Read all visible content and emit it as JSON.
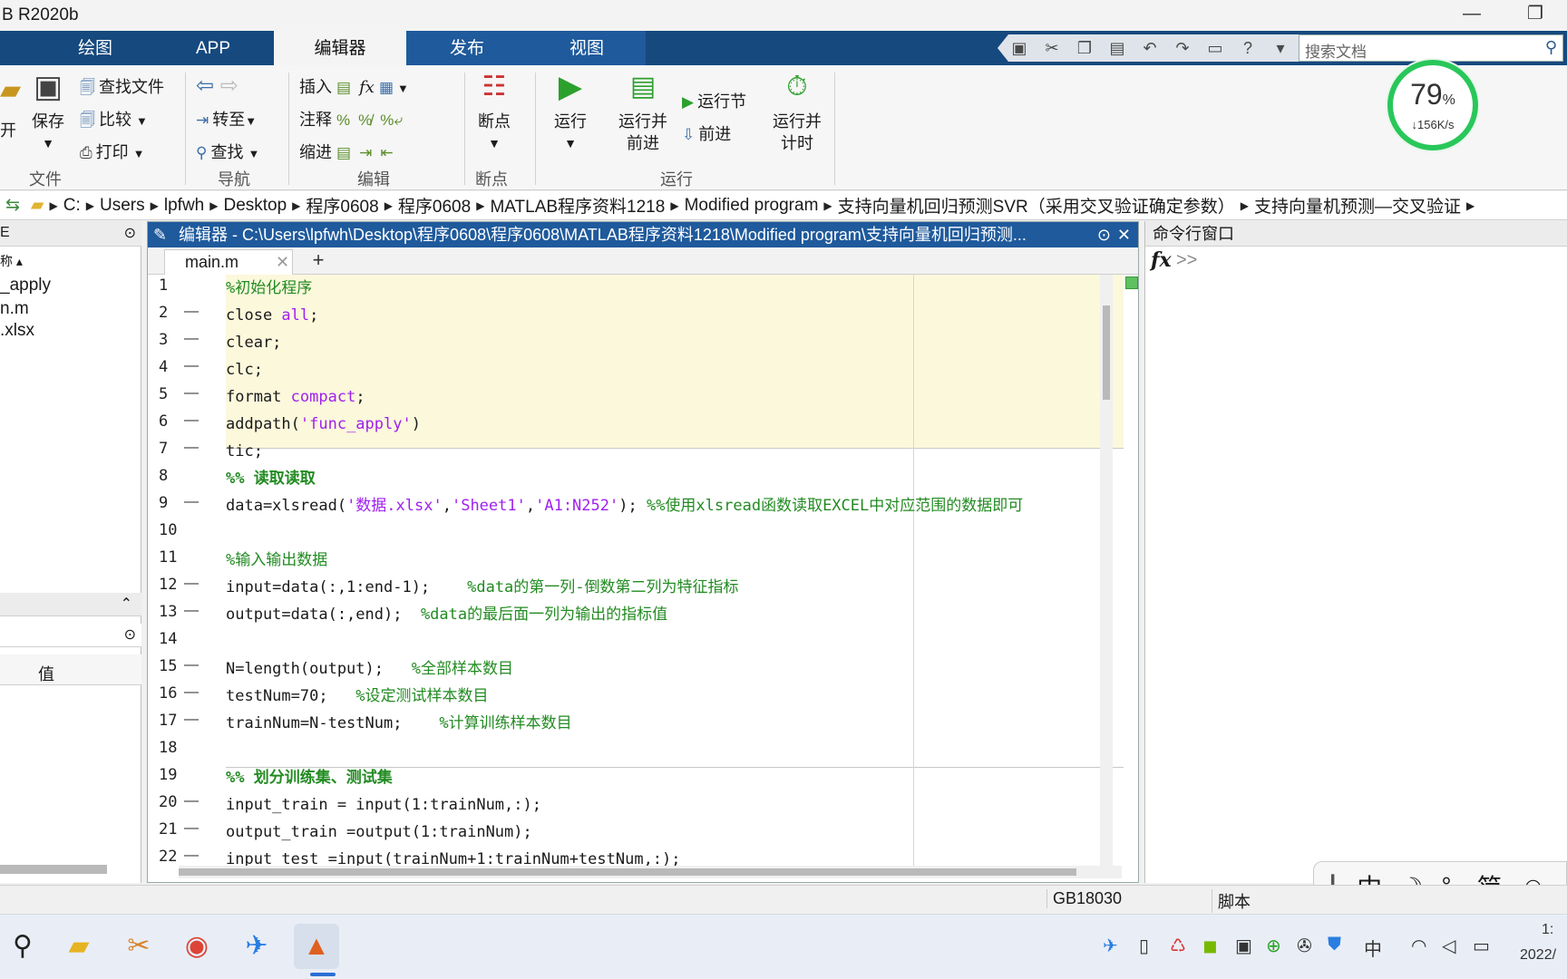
{
  "window": {
    "title": "B R2020b",
    "minimize": "—",
    "restore": "❐"
  },
  "tabs": [
    "绘图",
    "APP",
    "编辑器",
    "发布",
    "视图"
  ],
  "search": {
    "placeholder": "搜索文档"
  },
  "ribbon": {
    "file": {
      "open_partial": "开",
      "save": "保存",
      "find_files": "查找文件",
      "compare": "比较",
      "print": "打印",
      "group": "文件"
    },
    "nav": {
      "goto": "转至",
      "find": "查找",
      "group": "导航"
    },
    "edit": {
      "insert": "插入",
      "comment": "注释",
      "indent": "缩进",
      "group": "编辑"
    },
    "breakpoints": {
      "label": "断点",
      "group": "断点"
    },
    "run": {
      "run": "运行",
      "run_advance_1": "运行并",
      "run_advance_2": "前进",
      "run_section": "运行节",
      "advance": "前进",
      "run_time_1": "运行并",
      "run_time_2": "计时",
      "group": "运行"
    }
  },
  "meter": {
    "percent": "79",
    "percent_unit": "%",
    "speed": "↓156K/s"
  },
  "path": [
    "C:",
    "Users",
    "lpfwh",
    "Desktop",
    "程序0608",
    "程序0608",
    "MATLAB程序资料1218",
    "Modified program",
    "支持向量机回归预测SVR（采用交叉验证确定参数）",
    "支持向量机预测—交叉验证"
  ],
  "left_pane": {
    "header_partial": "E",
    "name_partial": "称",
    "files": [
      "_apply",
      "n.m",
      ".xlsx"
    ],
    "value_col": "值"
  },
  "editor": {
    "title": "编辑器 - C:\\Users\\lpfwh\\Desktop\\程序0608\\程序0608\\MATLAB程序资料1218\\Modified program\\支持向量机回归预测...",
    "tab": "main.m",
    "add_tab": "+",
    "lines": [
      {
        "n": "1",
        "dash": false,
        "parts": [
          {
            "t": "%初始化程序",
            "c": "cm"
          }
        ]
      },
      {
        "n": "2",
        "dash": true,
        "parts": [
          {
            "t": "close ",
            "c": ""
          },
          {
            "t": "all",
            "c": "kw"
          },
          {
            "t": ";",
            "c": ""
          }
        ]
      },
      {
        "n": "3",
        "dash": true,
        "parts": [
          {
            "t": "clear;",
            "c": ""
          }
        ]
      },
      {
        "n": "4",
        "dash": true,
        "parts": [
          {
            "t": "clc;",
            "c": ""
          }
        ]
      },
      {
        "n": "5",
        "dash": true,
        "parts": [
          {
            "t": "format ",
            "c": ""
          },
          {
            "t": "compact",
            "c": "kw"
          },
          {
            "t": ";",
            "c": ""
          }
        ]
      },
      {
        "n": "6",
        "dash": true,
        "parts": [
          {
            "t": "addpath(",
            "c": ""
          },
          {
            "t": "'func_apply'",
            "c": "st"
          },
          {
            "t": ")",
            "c": ""
          }
        ]
      },
      {
        "n": "7",
        "dash": true,
        "parts": [
          {
            "t": "tic;",
            "c": ""
          }
        ]
      },
      {
        "n": "8",
        "dash": false,
        "parts": [
          {
            "t": "%% 读取读取",
            "c": "cell"
          }
        ]
      },
      {
        "n": "9",
        "dash": true,
        "parts": [
          {
            "t": "data=xlsread(",
            "c": ""
          },
          {
            "t": "'数据.xlsx'",
            "c": "st"
          },
          {
            "t": ",",
            "c": ""
          },
          {
            "t": "'Sheet1'",
            "c": "st"
          },
          {
            "t": ",",
            "c": ""
          },
          {
            "t": "'A1:N252'",
            "c": "st"
          },
          {
            "t": "); ",
            "c": ""
          },
          {
            "t": "%%使用xlsread函数读取EXCEL中对应范围的数据即可",
            "c": "cm"
          }
        ]
      },
      {
        "n": "10",
        "dash": false,
        "parts": []
      },
      {
        "n": "11",
        "dash": false,
        "parts": [
          {
            "t": "%输入输出数据",
            "c": "cm"
          }
        ]
      },
      {
        "n": "12",
        "dash": true,
        "parts": [
          {
            "t": "input=data(:,1:end-1);    ",
            "c": ""
          },
          {
            "t": "%data的第一列-倒数第二列为特征指标",
            "c": "cm"
          }
        ]
      },
      {
        "n": "13",
        "dash": true,
        "parts": [
          {
            "t": "output=data(:,end);  ",
            "c": ""
          },
          {
            "t": "%data的最后面一列为输出的指标值",
            "c": "cm"
          }
        ]
      },
      {
        "n": "14",
        "dash": false,
        "parts": []
      },
      {
        "n": "15",
        "dash": true,
        "parts": [
          {
            "t": "N=length(output);   ",
            "c": ""
          },
          {
            "t": "%全部样本数目",
            "c": "cm"
          }
        ]
      },
      {
        "n": "16",
        "dash": true,
        "parts": [
          {
            "t": "testNum=70;   ",
            "c": ""
          },
          {
            "t": "%设定测试样本数目",
            "c": "cm"
          }
        ]
      },
      {
        "n": "17",
        "dash": true,
        "parts": [
          {
            "t": "trainNum=N-testNum;    ",
            "c": ""
          },
          {
            "t": "%计算训练样本数目",
            "c": "cm"
          }
        ]
      },
      {
        "n": "18",
        "dash": false,
        "parts": []
      },
      {
        "n": "19",
        "dash": false,
        "parts": [
          {
            "t": "%% 划分训练集、测试集",
            "c": "cell"
          }
        ]
      },
      {
        "n": "20",
        "dash": true,
        "parts": [
          {
            "t": "input_train = input(1:trainNum,:);",
            "c": ""
          }
        ]
      },
      {
        "n": "21",
        "dash": true,
        "parts": [
          {
            "t": "output_train =output(1:trainNum);",
            "c": ""
          }
        ]
      },
      {
        "n": "22",
        "dash": true,
        "parts": [
          {
            "t": "input_test =input(trainNum+1:trainNum+testNum,:);",
            "c": ""
          }
        ]
      }
    ]
  },
  "command_window": {
    "title": "命令行窗口",
    "fx": "fx",
    "prompt": ">>"
  },
  "ime": [
    "中",
    "☽",
    "°,",
    "简",
    "☺"
  ],
  "status": {
    "encoding": "GB18030",
    "mode": "脚本"
  },
  "taskbar": {
    "tray_lang": "中",
    "clock_time": "1:",
    "clock_date": "2022/"
  }
}
